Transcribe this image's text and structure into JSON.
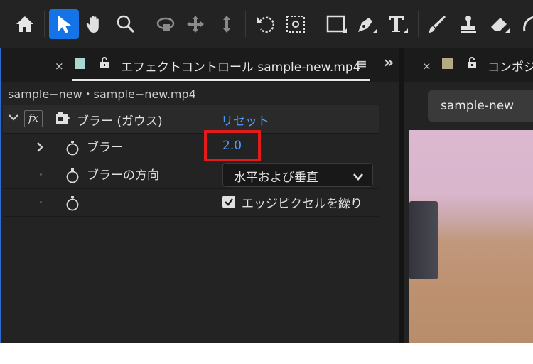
{
  "toolbar": {
    "tools": [
      "home-icon",
      "selection-tool-icon",
      "hand-tool-icon",
      "zoom-tool-icon",
      "orbit-camera-icon",
      "pan-camera-icon",
      "dolly-camera-icon",
      "rotate-tool-icon",
      "pan-behind-icon",
      "rectangle-tool-icon",
      "pen-tool-icon",
      "type-tool-icon",
      "brush-tool-icon",
      "clone-stamp-icon",
      "eraser-tool-icon",
      "roto-brush-icon"
    ],
    "active_tool": "selection-tool-icon",
    "accent_color": "#1473e6"
  },
  "effect_controls": {
    "tab_title": "エフェクトコントロール sample-new.mp4",
    "tab_close": "×",
    "menu_icon": "≡",
    "expand_icon": "»",
    "breadcrumb": "sample−new・sample−new.mp4",
    "effect": {
      "fx_label": "fx",
      "name": "ブラー (ガウス)",
      "reset_label": "リセット"
    },
    "properties": {
      "blurriness": {
        "label": "ブラー",
        "value": "2.0",
        "highlight_color": "#e41b1b"
      },
      "direction": {
        "label": "ブラーの方向",
        "value": "水平および垂直"
      },
      "repeat_edge": {
        "label": "エッジピクセルを繰り",
        "checked": true
      }
    },
    "link_color": "#4d9dff"
  },
  "composition": {
    "tab_close": "×",
    "tab_title": "コンポジシ",
    "comp_name": "sample-new"
  }
}
